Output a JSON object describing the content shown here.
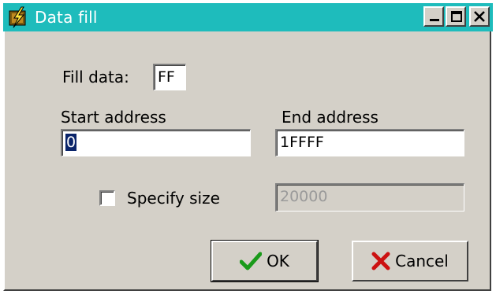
{
  "window": {
    "title": "Data fill",
    "icon": "data-fill-app-icon",
    "buttons": {
      "minimize": "minimize-icon",
      "maximize": "maximize-icon",
      "close": "close-icon"
    }
  },
  "form": {
    "fill_data_label": "Fill data:",
    "fill_data_value": "FF",
    "start_address_label": "Start address",
    "start_address_value": "0",
    "end_address_label": "End address",
    "end_address_value": "1FFFF",
    "specify_size_label": "Specify size",
    "specify_size_checked": false,
    "size_value": "20000"
  },
  "actions": {
    "ok_label": "OK",
    "cancel_label": "Cancel"
  },
  "colors": {
    "titlebar": "#1ebcbc",
    "face": "#d4d0c8",
    "ok_check": "#1a9a1a",
    "cancel_x": "#cc1111"
  }
}
